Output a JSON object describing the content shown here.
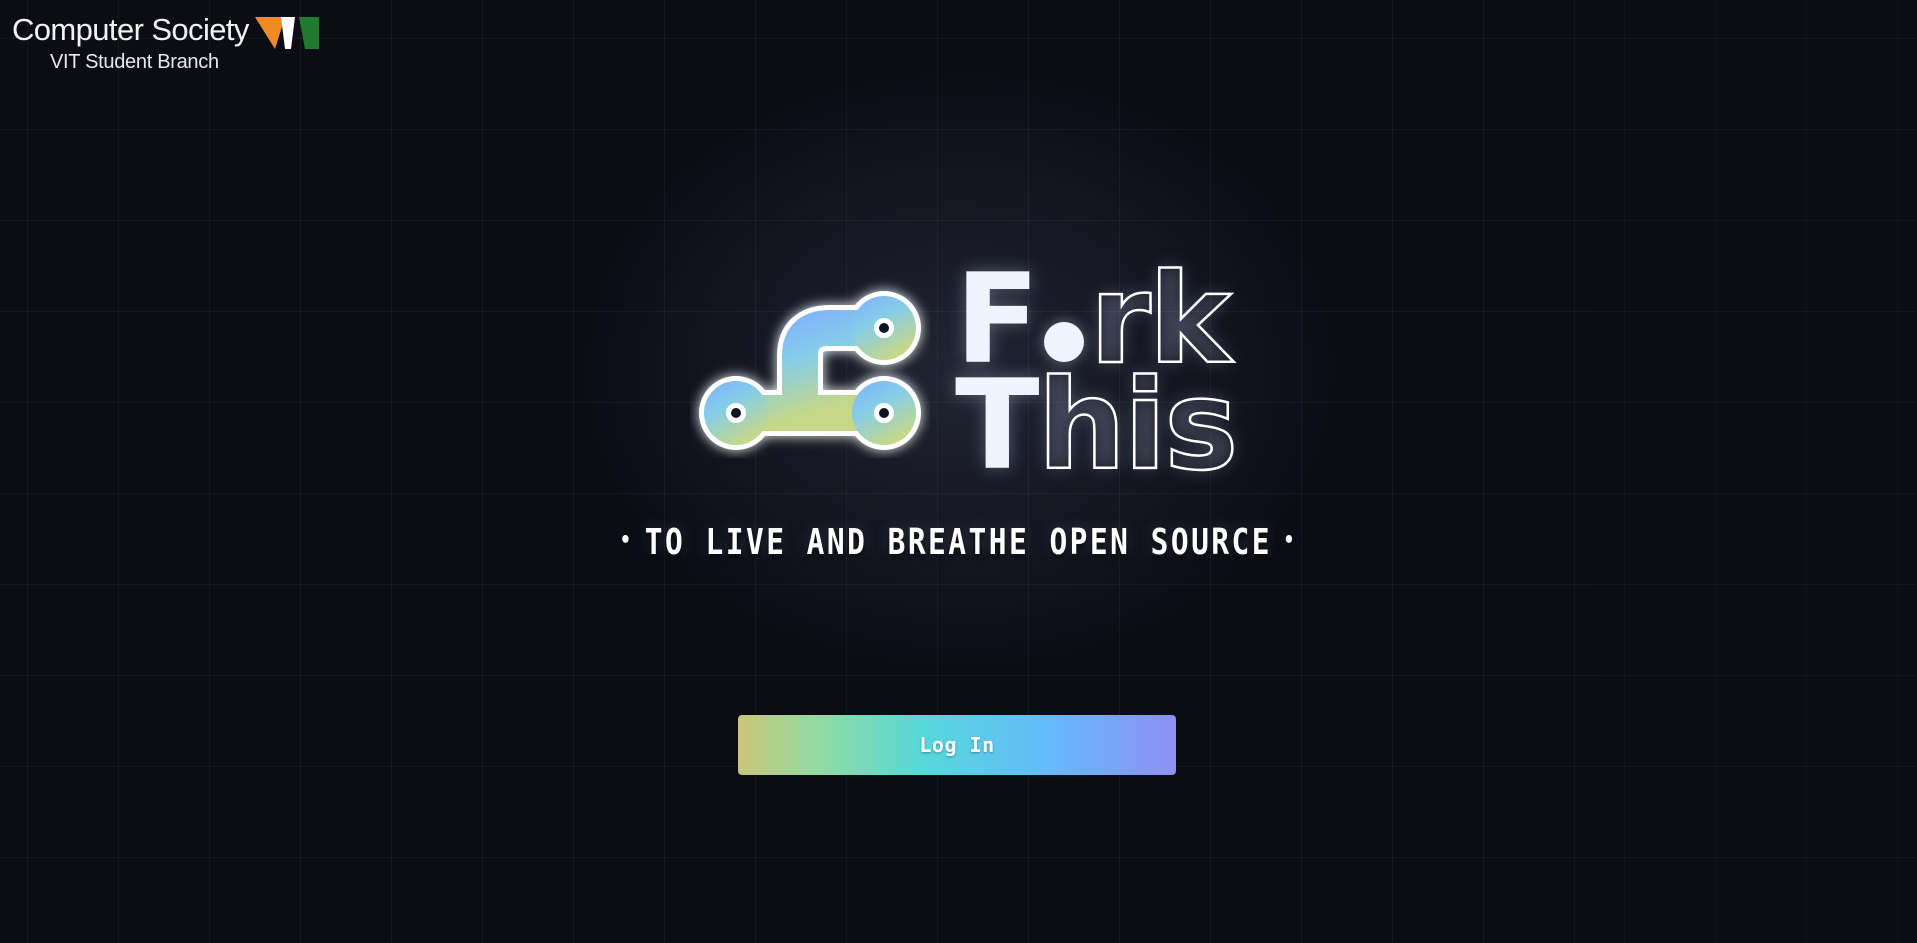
{
  "brand": {
    "title": "Computer Society",
    "subtitle": "VIT Student Branch",
    "flag_colors": [
      "#f08a24",
      "#ffffff",
      "#1f7a2e"
    ]
  },
  "hero": {
    "logo_icon": "git-fork-icon",
    "word1": {
      "first": "F",
      "dot_letter": "o",
      "rest": "rk"
    },
    "word2": {
      "first": "T",
      "rest": "his"
    },
    "tagline": "TO LIVE AND BREATHE OPEN SOURCE",
    "tagline_bullet": "•"
  },
  "login": {
    "label": "Log In",
    "gradient": [
      "#c9c67a",
      "#94dba2",
      "#55d8d8",
      "#66b8ff",
      "#8f8ff2"
    ]
  },
  "colors": {
    "background": "#0b0c14",
    "text": "#ffffff"
  }
}
